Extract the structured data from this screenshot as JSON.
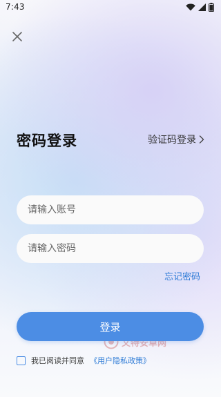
{
  "status_bar": {
    "time": "7:43"
  },
  "icons": {
    "close": "close-icon",
    "chevron": "chevron-right-icon",
    "wifi": "wifi-icon",
    "signal": "signal-icon",
    "battery": "battery-icon"
  },
  "login": {
    "title": "密码登录",
    "switch_label": "验证码登录",
    "account_placeholder": "请输入账号",
    "password_placeholder": "请输入密码",
    "forgot_label": "忘记密码",
    "button_label": "登录"
  },
  "agreement": {
    "text": "我已阅读并同意",
    "policy_link": "《用户隐私政策》",
    "checked": false
  },
  "watermark": {
    "text": "文特安卓网"
  },
  "colors": {
    "accent": "#4c8de4",
    "link": "#2e7bd6",
    "title": "#111111"
  }
}
